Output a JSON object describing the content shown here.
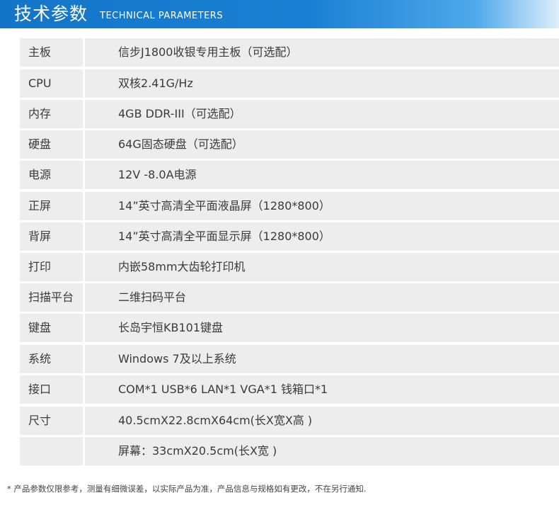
{
  "header": {
    "title": "技术参数",
    "subtitle": "TECHNICAL PARAMETERS",
    "colors": {
      "bar": "#1a7fd2",
      "text": "#ffffff"
    }
  },
  "specs": [
    {
      "label": "主板",
      "value": "信步J1800收银专用主板（可选配）"
    },
    {
      "label": "CPU",
      "value": "双核2.41G/Hz"
    },
    {
      "label": "内存",
      "value": "4GB  DDR-III（可选配）"
    },
    {
      "label": "硬盘",
      "value": "64G固态硬盘（可选配）"
    },
    {
      "label": "电源",
      "value": "12V -8.0A电源"
    },
    {
      "label": "正屏",
      "value": "14”英寸高清全平面液晶屏（1280*800）"
    },
    {
      "label": "背屏",
      "value": "14”英寸高清全平面显示屏（1280*800）"
    },
    {
      "label": "打印",
      "value": "内嵌58mm大齿轮打印机"
    },
    {
      "label": "扫描平台",
      "value": "二维扫码平台"
    },
    {
      "label": "键盘",
      "value": "长岛宇恒KB101键盘"
    },
    {
      "label": "系统",
      "value": "Windows 7及以上系统"
    },
    {
      "label": "接口",
      "value": "COM*1  USB*6  LAN*1  VGA*1  钱箱口*1"
    },
    {
      "label": "尺寸",
      "value": "40.5cmX22.8cmX64cm(长X宽X高 )"
    },
    {
      "label": "",
      "value": "屏幕：33cmX20.5cm(长X宽 )"
    }
  ],
  "footnote": "*  产品参数仅限参考，测量有细微误差，以实际产品为准，产品信息与规格如有更改，不在另行通知."
}
